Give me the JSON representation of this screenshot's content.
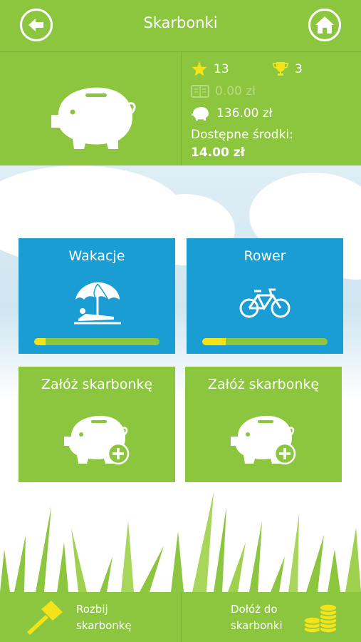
{
  "header": {
    "title": "Skarbonki",
    "back_icon": "back-arrow-icon",
    "home_icon": "home-icon"
  },
  "stats": {
    "stars": "13",
    "trophies": "3",
    "wallet_amount": "0.00 zł",
    "piggy_amount": "136.00 zł",
    "available_label": "Dostępne środki:",
    "available_value": "14.00 zł"
  },
  "tiles": [
    {
      "title": "Wakacje",
      "icon": "beach-umbrella-icon",
      "progress": 0.09
    },
    {
      "title": "Rower",
      "icon": "bicycle-icon",
      "progress": 0.19
    },
    {
      "title": "Załóż skarbonkę",
      "icon": "add-piggy-bank-icon"
    },
    {
      "title": "Załóż skarbonkę",
      "icon": "add-piggy-bank-icon"
    }
  ],
  "footer": {
    "break_label_1": "Rozbij",
    "break_label_2": "skarbonkę",
    "add_label_1": "Dołóż do",
    "add_label_2": "skarbonki"
  },
  "colors": {
    "green": "#8cc63f",
    "blue": "#1a9dd2",
    "yellow": "#f5e31a"
  }
}
